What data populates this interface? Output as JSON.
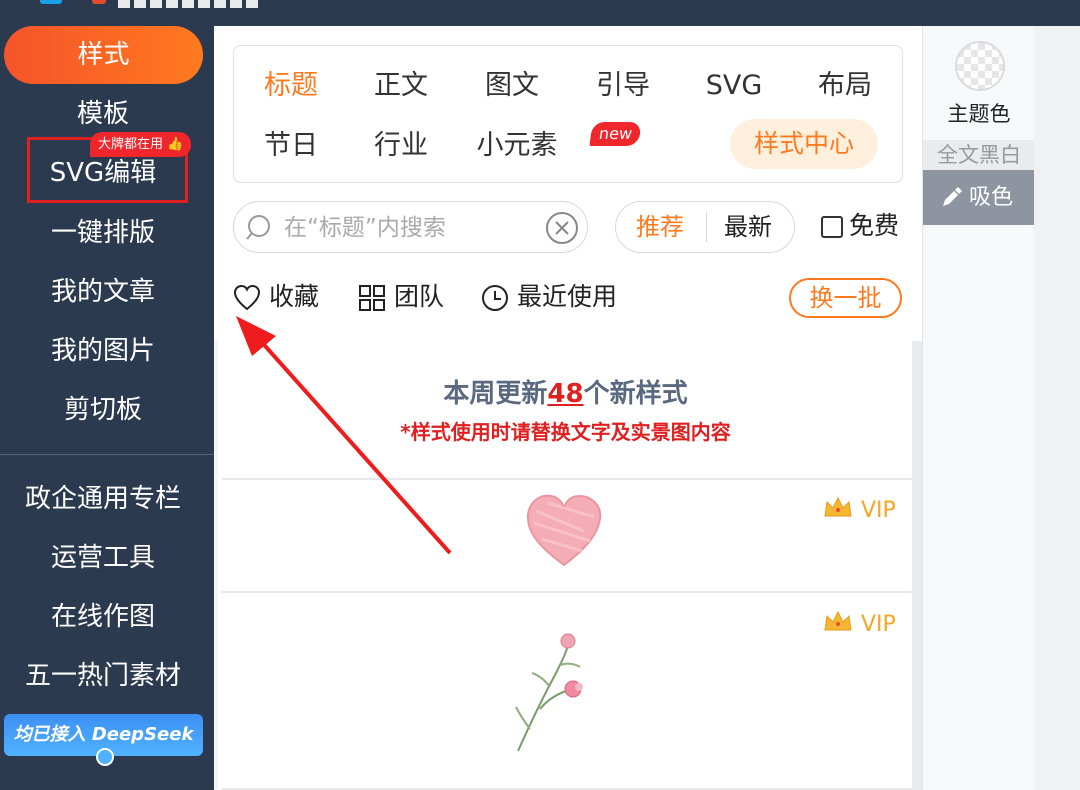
{
  "sidebar": {
    "items": [
      {
        "label": "样式"
      },
      {
        "label": "模板"
      },
      {
        "label": "SVG编辑"
      },
      {
        "label": "一键排版"
      },
      {
        "label": "我的文章"
      },
      {
        "label": "我的图片"
      },
      {
        "label": "剪切板"
      },
      {
        "label": "政企通用专栏"
      },
      {
        "label": "运营工具"
      },
      {
        "label": "在线作图"
      },
      {
        "label": "五一热门素材"
      }
    ],
    "hot_badge": "大牌都在用",
    "deepseek_banner": "均已接入 DeepSeek"
  },
  "categories": {
    "row1": [
      "标题",
      "正文",
      "图文",
      "引导",
      "SVG",
      "布局"
    ],
    "row2": [
      "节日",
      "行业",
      "小元素"
    ],
    "new_badge": "new",
    "style_center": "样式中心"
  },
  "search": {
    "placeholder": "在“标题”内搜索",
    "value": ""
  },
  "sort": {
    "recommend": "推荐",
    "latest": "最新"
  },
  "filter": {
    "free_label": "免费"
  },
  "tools": {
    "favorite": "收藏",
    "team": "团队",
    "recent": "最近使用",
    "refresh": "换一批"
  },
  "announcement": {
    "prefix": "本周更新",
    "count": "48",
    "suffix": "个新样式",
    "note": "*样式使用时请替换文字及实景图内容"
  },
  "cards": [
    {
      "badge": "VIP"
    },
    {
      "badge": "VIP"
    }
  ],
  "right_panel": {
    "theme_color": "主题色",
    "black_white": "全文黑白",
    "color_picker": "吸色"
  },
  "colors": {
    "sidebar_bg": "#2c3a4f",
    "accent_orange": "#ff7a1f",
    "alert_red": "#e02020",
    "vip_gold": "#f5a623"
  }
}
